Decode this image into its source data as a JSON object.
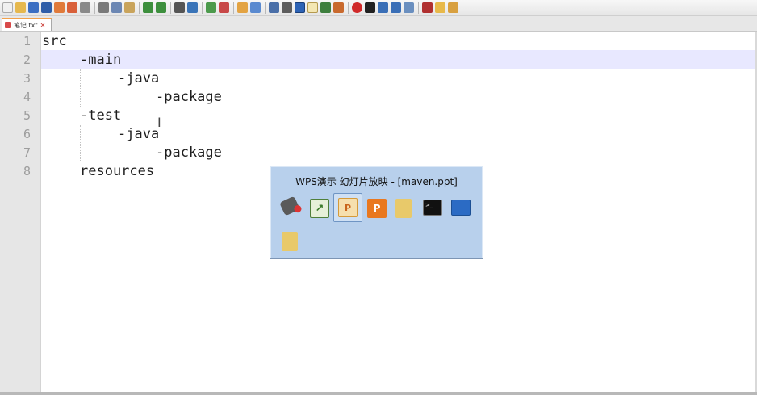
{
  "toolbar": {
    "icons": [
      "new-file",
      "open-file",
      "save",
      "save-all",
      "close",
      "close-all",
      "print",
      "cut",
      "copy",
      "paste",
      "undo",
      "redo",
      "find",
      "replace",
      "zoom-in",
      "zoom-out",
      "sync-v",
      "sync-h",
      "word-wrap",
      "show-all",
      "indent-guide",
      "folder-as-workspace",
      "document-map",
      "function-list",
      "record-macro",
      "stop-record",
      "play-macro",
      "run-multiple",
      "save-macro",
      "spell-check",
      "open-folder",
      "settings"
    ]
  },
  "tab": {
    "label": "笔记.txt"
  },
  "editor": {
    "line_numbers": [
      "1",
      "2",
      "3",
      "4",
      "5",
      "6",
      "7",
      "8"
    ],
    "lines": [
      "src",
      "-main",
      "-java",
      "-package",
      "-test",
      "-java",
      "-package",
      "resources"
    ],
    "highlighted_line": 2
  },
  "switcher": {
    "title": "WPS演示 幻灯片放映 - [maven.ppt]",
    "apps": [
      "game-controller-icon",
      "chart-editor-icon",
      "wps-presentation-icon",
      "powerpoint-icon",
      "folder-icon",
      "terminal-icon",
      "desktop-icon",
      "folder-icon"
    ],
    "selected_index": 2
  },
  "colors": {
    "highlight": "#e8e8ff",
    "switcher_bg": "#b8d0ec",
    "tab_accent": "#f2a14b"
  }
}
